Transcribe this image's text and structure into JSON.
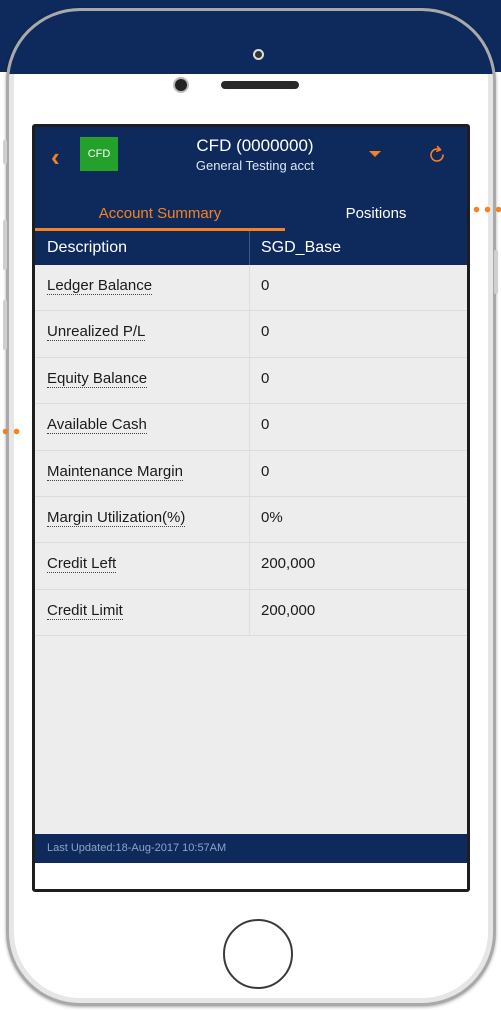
{
  "header": {
    "badge": "CFD",
    "account_title": "CFD (0000000)",
    "account_subtitle": "General Testing acct",
    "back_icon": "chevron-left-icon",
    "dropdown_icon": "caret-down-icon",
    "refresh_icon": "refresh-icon"
  },
  "tabs": [
    {
      "label": "Account Summary",
      "active": true
    },
    {
      "label": "Positions",
      "active": false
    }
  ],
  "table": {
    "columns": [
      "Description",
      "SGD_Base"
    ],
    "rows": [
      {
        "label": "Ledger Balance",
        "value": "0"
      },
      {
        "label": "Unrealized P/L",
        "value": "0"
      },
      {
        "label": "Equity Balance",
        "value": "0"
      },
      {
        "label": "Available Cash",
        "value": "0"
      },
      {
        "label": "Maintenance Margin",
        "value": "0"
      },
      {
        "label": "Margin Utilization(%)",
        "value": "0%"
      },
      {
        "label": "Credit Left",
        "value": "200,000"
      },
      {
        "label": "Credit Limit",
        "value": "200,000"
      }
    ]
  },
  "footer": {
    "last_updated": "Last Updated:18-Aug-2017 10:57AM"
  },
  "colors": {
    "navy": "#0e2a5c",
    "accent_orange": "#f58220",
    "badge_green": "#24a12b",
    "content_bg": "#ededed"
  }
}
